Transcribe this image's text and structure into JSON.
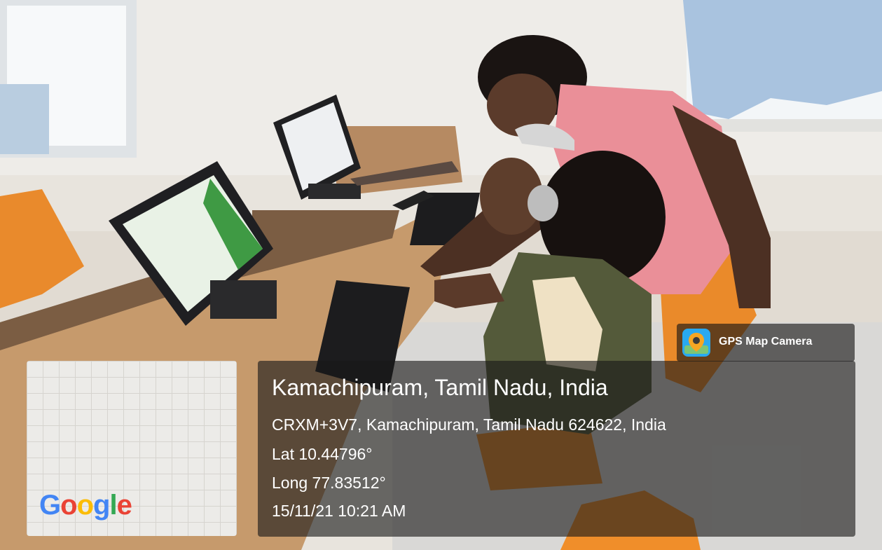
{
  "app_badge": {
    "name": "GPS Map Camera",
    "icon": "map-pin-icon"
  },
  "map_thumbnail": {
    "logo_text": "Google",
    "logo_colors": [
      "#4285F4",
      "#EA4335",
      "#FBBC05",
      "#4285F4",
      "#34A853",
      "#EA4335"
    ]
  },
  "location": {
    "title": "Kamachipuram, Tamil Nadu, India",
    "address": "CRXM+3V7, Kamachipuram, Tamil Nadu 624622, India",
    "latitude": "Lat 10.44796°",
    "longitude": "Long 77.83512°",
    "datetime": "15/11/21 10:21 AM"
  },
  "colors": {
    "overlay": "#191919",
    "text": "#ffffff"
  }
}
